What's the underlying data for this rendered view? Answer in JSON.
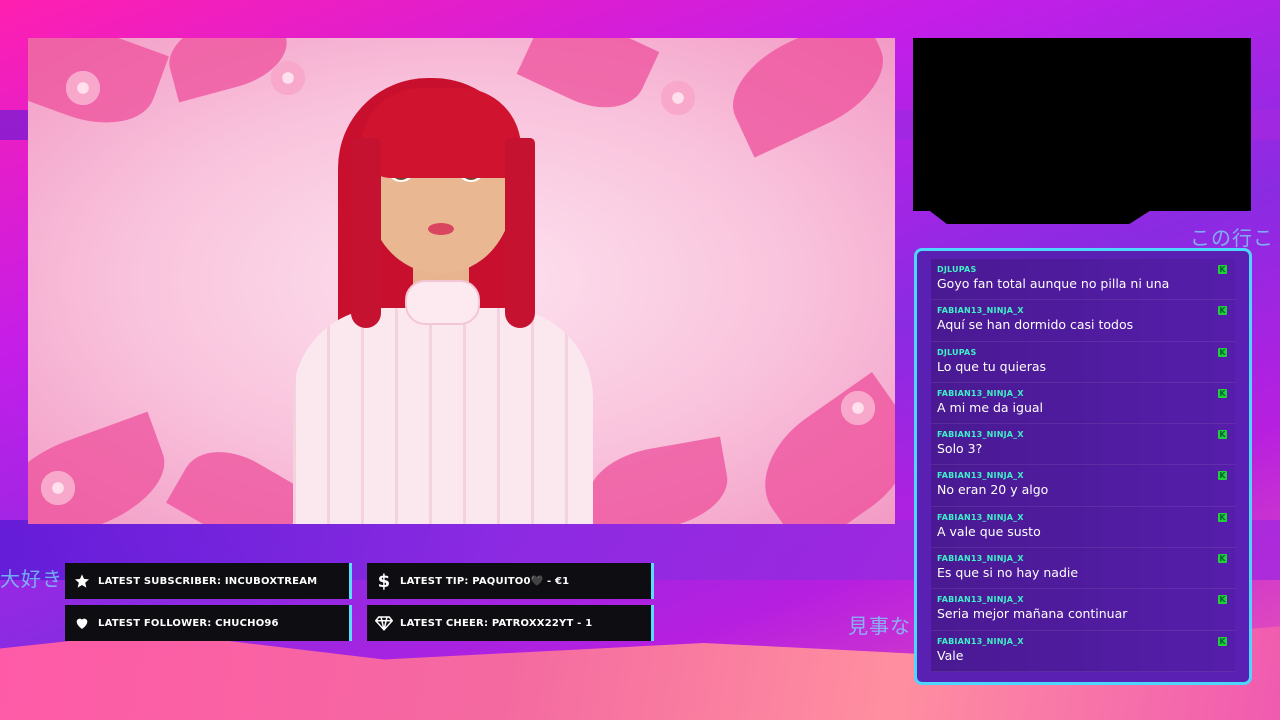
{
  "overlay": {
    "jp_left": "大好き",
    "jp_right": "見事な",
    "jp_top": "この行こ"
  },
  "alerts": {
    "latest_subscriber": "LATEST SUBSCRIBER: INCUBOXTREAM",
    "latest_tip": "LATEST TIP: PAQUITO0🖤 - €1",
    "latest_follower": "LATEST FOLLOWER: CHUCHO96",
    "latest_cheer": "LATEST CHEER: PATROXX22YT - 1"
  },
  "icons": {
    "subscriber": "star-icon",
    "tip": "dollar-icon",
    "follower": "heart-icon",
    "cheer": "diamond-icon"
  },
  "chat": {
    "messages": [
      {
        "user": "DJLUPAS",
        "text": "Goyo fan total aunque no pilla ni una"
      },
      {
        "user": "FABIAN13_NINJA_X",
        "text": "Aquí se han dormido casi todos"
      },
      {
        "user": "DJLUPAS",
        "text": "Lo que tu quieras"
      },
      {
        "user": "FABIAN13_NINJA_X",
        "text": "A mi me da igual"
      },
      {
        "user": "FABIAN13_NINJA_X",
        "text": "Solo 3?"
      },
      {
        "user": "FABIAN13_NINJA_X",
        "text": "No eran 20 y algo"
      },
      {
        "user": "FABIAN13_NINJA_X",
        "text": "A vale que susto"
      },
      {
        "user": "FABIAN13_NINJA_X",
        "text": "Es que si no hay nadie"
      },
      {
        "user": "FABIAN13_NINJA_X",
        "text": "Seria mejor mañana continuar"
      },
      {
        "user": "FABIAN13_NINJA_X",
        "text": "Vale"
      }
    ]
  },
  "colors": {
    "chat_border": "#4fd6ff",
    "username": "#3ff0c8",
    "badge": "#22d13a"
  }
}
